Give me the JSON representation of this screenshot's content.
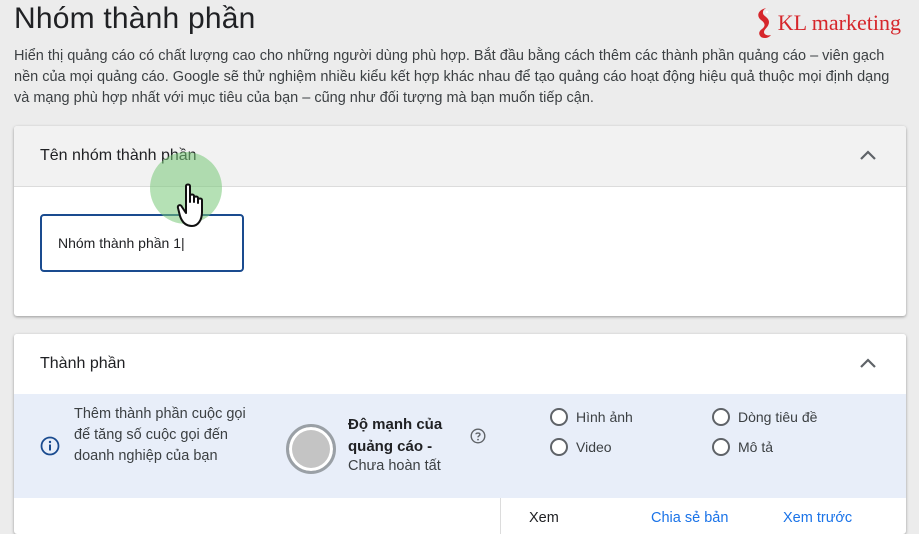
{
  "page": {
    "title": "Nhóm thành phần",
    "intro": "Hiển thị quảng cáo có chất lượng cao cho những người dùng phù hợp. Bắt đầu bằng cách thêm các thành phần quảng cáo – viên gạch nền của mọi quảng cáo. Google sẽ thử nghiệm nhiều kiểu kết hợp khác nhau để tạo quảng cáo hoạt động hiệu quả thuộc mọi định dạng và mạng phù hợp nhất với mục tiêu của bạn – cũng như đối tượng mà bạn muốn tiếp cận."
  },
  "brand": {
    "text": "KL marketing",
    "color": "#d6262b"
  },
  "asset_group_name": {
    "title": "Tên nhóm thành phần",
    "value": "Nhóm thành phần 1|"
  },
  "assets": {
    "title": "Thành phần",
    "banner_text": "Thêm thành phần cuộc gọi để tăng số cuộc gọi đến doanh nghiệp của bạn",
    "strength_label": "Độ mạnh của quảng cáo -",
    "strength_status": "Chưa hoàn tất",
    "checklist": [
      "Hình ảnh",
      "Dòng tiêu đề",
      "Video",
      "Mô tả"
    ],
    "footer": {
      "view": "Xem",
      "share": "Chia sẻ bản",
      "preview": "Xem trước"
    }
  },
  "colors": {
    "accent": "#1a4b8f",
    "link": "#1a73e8",
    "banner_bg": "#e8eef9"
  }
}
